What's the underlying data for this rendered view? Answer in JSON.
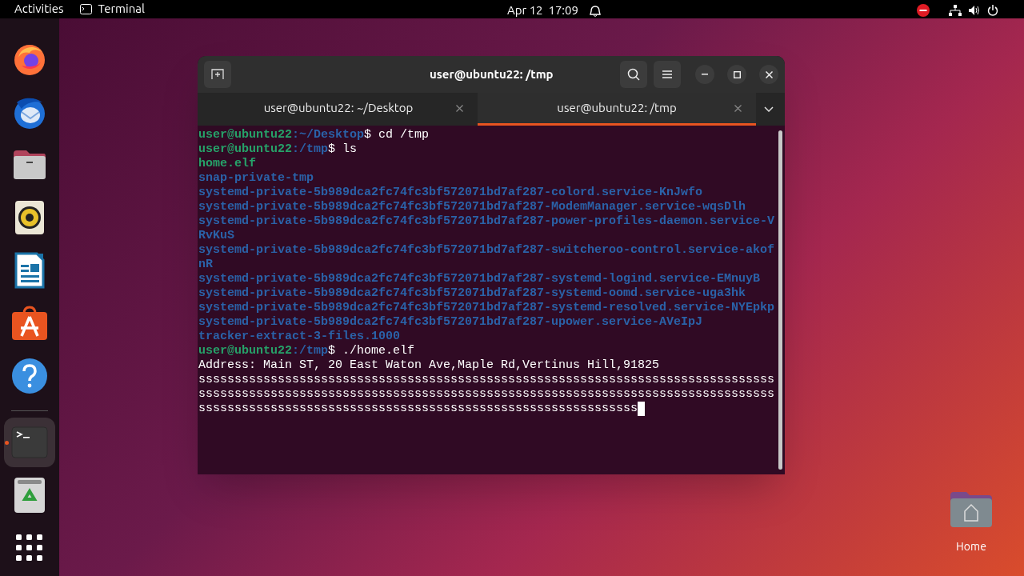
{
  "top_bar": {
    "activities": "Activities",
    "app": "Terminal",
    "clock": "Apr 12  17:09"
  },
  "dock": {
    "items": [
      {
        "kind": "firefox",
        "running": false
      },
      {
        "kind": "thunderbird",
        "running": false
      },
      {
        "kind": "files",
        "running": false
      },
      {
        "kind": "rhythmbox",
        "running": false
      },
      {
        "kind": "writer",
        "running": false
      },
      {
        "kind": "software",
        "running": false
      },
      {
        "kind": "help",
        "running": false
      },
      {
        "kind": "separator"
      },
      {
        "kind": "terminal",
        "running": true
      },
      {
        "kind": "trash",
        "running": false
      },
      {
        "kind": "apps",
        "running": false
      }
    ]
  },
  "desktop_icons": [
    {
      "label": "Home"
    }
  ],
  "window": {
    "title": "user@ubuntu22: /tmp",
    "tabs": [
      {
        "label": "user@ubuntu22: ~/Desktop",
        "selected": false
      },
      {
        "label": "user@ubuntu22: /tmp",
        "selected": true
      }
    ],
    "lines": [
      {
        "kind": "prompt",
        "user": "user@ubuntu22",
        "path": ":~/Desktop",
        "command": "$ cd /tmp"
      },
      {
        "kind": "prompt",
        "user": "user@ubuntu22",
        "path": ":/tmp",
        "command": "$ ls"
      },
      {
        "kind": "file",
        "text": "home.elf"
      },
      {
        "kind": "dir",
        "text": "snap-private-tmp"
      },
      {
        "kind": "dir",
        "text": "systemd-private-5b989dca2fc74fc3bf572071bd7af287-colord.service-KnJwfo"
      },
      {
        "kind": "dir",
        "text": "systemd-private-5b989dca2fc74fc3bf572071bd7af287-ModemManager.service-wqsDlh"
      },
      {
        "kind": "dir",
        "text": "systemd-private-5b989dca2fc74fc3bf572071bd7af287-power-profiles-daemon.service-V"
      },
      {
        "kind": "dir",
        "text": "RvKuS"
      },
      {
        "kind": "dir",
        "text": "systemd-private-5b989dca2fc74fc3bf572071bd7af287-switcheroo-control.service-akof"
      },
      {
        "kind": "dir",
        "text": "nR"
      },
      {
        "kind": "dir",
        "text": "systemd-private-5b989dca2fc74fc3bf572071bd7af287-systemd-logind.service-EMnuyB"
      },
      {
        "kind": "dir",
        "text": "systemd-private-5b989dca2fc74fc3bf572071bd7af287-systemd-oomd.service-uga3hk"
      },
      {
        "kind": "dir",
        "text": "systemd-private-5b989dca2fc74fc3bf572071bd7af287-systemd-resolved.service-NYEpkp"
      },
      {
        "kind": "dir",
        "text": "systemd-private-5b989dca2fc74fc3bf572071bd7af287-upower.service-AVeIpJ"
      },
      {
        "kind": "dir",
        "text": "tracker-extract-3-files.1000"
      },
      {
        "kind": "prompt",
        "user": "user@ubuntu22",
        "path": ":/tmp",
        "command": "$ ./home.elf"
      },
      {
        "kind": "output",
        "text": "Address: Main ST, 20 East Waton Ave,Maple Rd,Vertinus Hill,91825"
      },
      {
        "kind": "output",
        "text": "ssssssssssssssssssssssssssssssssssssssssssssssssssssssssssssssssssssssssssssssss"
      },
      {
        "kind": "output",
        "text": "ssssssssssssssssssssssssssssssssssssssssssssssssssssssssssssssssssssssssssssssss"
      },
      {
        "kind": "output",
        "text": "sssssssssssssssssssssssssssssssssssssssssssssssssssssssssssss",
        "cursor": true
      }
    ]
  }
}
